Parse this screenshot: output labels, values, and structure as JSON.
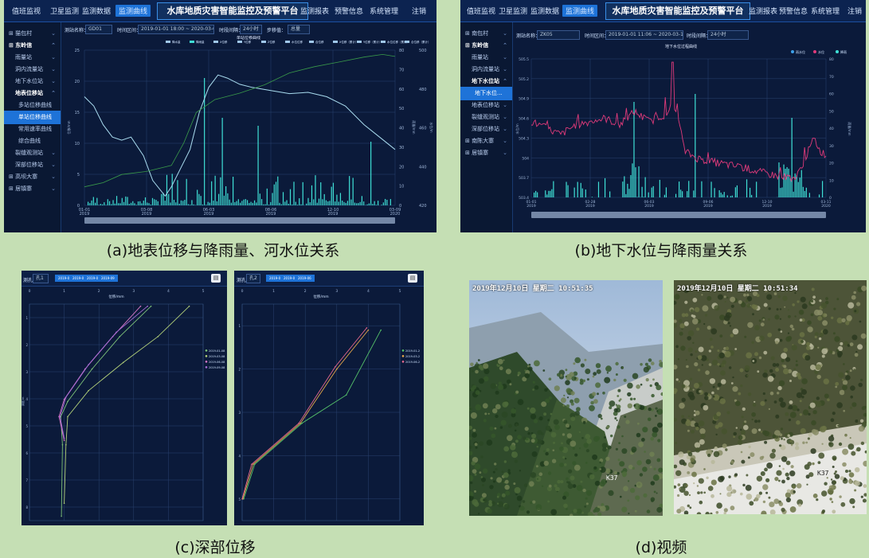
{
  "captions": {
    "a": "(a)地表位移与降雨量、河水位关系",
    "b": "(b)地下水位与降雨量关系",
    "c": "(c)深部位移",
    "d": "(d)视频"
  },
  "app": {
    "title": "水库地质灾害智能监控及预警平台",
    "nav_left": [
      "值班监视",
      "卫星监测",
      "监测数据",
      "监测曲线"
    ],
    "nav_right": [
      "监测报表",
      "预警信息",
      "系统管理"
    ],
    "logout": "注销"
  },
  "panel_a": {
    "sidebar": [
      {
        "label": "猫包村",
        "level": 0
      },
      {
        "label": "东岭信",
        "level": 0,
        "head": true
      },
      {
        "label": "雨量站",
        "level": 1
      },
      {
        "label": "洞内流量站",
        "level": 1
      },
      {
        "label": "地下水位站",
        "level": 1
      },
      {
        "label": "地表位移站",
        "level": 1,
        "head": true
      },
      {
        "label": "多站位移曲线",
        "level": 2
      },
      {
        "label": "单站位移曲线",
        "level": 2,
        "on": true
      },
      {
        "label": "常用速率曲线",
        "level": 2
      },
      {
        "label": "综合曲线",
        "level": 2
      },
      {
        "label": "裂缝观测站",
        "level": 1
      },
      {
        "label": "深部位移站",
        "level": 1
      },
      {
        "label": "高坝大寨",
        "level": 0
      },
      {
        "label": "居镇寨",
        "level": 0
      }
    ],
    "filters": {
      "station_label": "测站名称：",
      "station_value": "GD01",
      "time_label": "时间区间：",
      "time_value": "2019-01-01 18:00 ~ 2020-03-09 18:00",
      "step_label": "时段间隔：",
      "step_value": "24小时",
      "type_label": "步移值：",
      "type_value": "总量"
    },
    "chart_title": "单站位移曲线",
    "legend": [
      "降水量",
      "降雨量",
      "X位移",
      "Y位移",
      "Z位移",
      "水位位移",
      "合位移",
      "X位移（累计）",
      "Y位移（累计）",
      "水位位移（累计）",
      "合位移（累计）"
    ],
    "left_axis_ticks": [
      "0",
      "5",
      "10",
      "15",
      "20",
      "25"
    ],
    "right_axis1_ticks": [
      "0",
      "10",
      "20",
      "30",
      "40",
      "50",
      "60",
      "70",
      "80"
    ],
    "right_axis2_ticks": [
      "420",
      "440",
      "460",
      "480",
      "500"
    ],
    "x_ticks": [
      "01-01\n2019",
      "03-08\n2019",
      "06-03\n2019",
      "08-06\n2019",
      "12-10\n2019",
      "03-09\n2020"
    ],
    "left_axis_name": "位移/mm",
    "right_axis_name": "雨量/mm",
    "right_axis2_name": "水位/m"
  },
  "panel_b": {
    "sidebar": [
      {
        "label": "南包村",
        "level": 0
      },
      {
        "label": "东岭信",
        "level": 0,
        "head": true
      },
      {
        "label": "雨量站",
        "level": 1
      },
      {
        "label": "洞内流量站",
        "level": 1
      },
      {
        "label": "地下水位站",
        "level": 1,
        "head": true
      },
      {
        "label": "地下水位...",
        "level": 2,
        "on": true
      },
      {
        "label": "地表位移站",
        "level": 1
      },
      {
        "label": "裂缝观测站",
        "level": 1
      },
      {
        "label": "深部位移站",
        "level": 1
      },
      {
        "label": "南陈大寨",
        "level": 0
      },
      {
        "label": "居镇寨",
        "level": 0
      }
    ],
    "filters": {
      "station_label": "测站名称：",
      "station_value": "ZK05",
      "time_label": "时间区间：",
      "time_value": "2019-01-01 11:06 ~ 2020-03-11 11:06",
      "step_label": "时段间隔：",
      "step_value": "24小时"
    },
    "chart_title": "地下水位过程曲线",
    "legend": [
      "雨水位",
      "水位",
      "降雨"
    ],
    "left_axis_ticks": [
      "503.4",
      "503.7",
      "504",
      "504.3",
      "504.6",
      "504.9",
      "505.2",
      "505.5"
    ],
    "right_axis_ticks": [
      "0",
      "10",
      "20",
      "30",
      "40",
      "50",
      "60",
      "70",
      "80"
    ],
    "x_ticks": [
      "01-01\n2019",
      "02-28\n2019",
      "06-03\n2019",
      "09-06\n2019",
      "12-10\n2019",
      "03-11\n2020"
    ],
    "left_axis_name": "水位/m",
    "right_axis_name": "雨量/mm"
  },
  "panel_c": {
    "left": {
      "label": "测孔：",
      "select": "孔1",
      "tags": [
        "2019-01",
        "2019-03",
        "2019-06",
        "2019-09"
      ],
      "title": "位移/mm",
      "x_ticks": [
        "0",
        "1",
        "2",
        "3",
        "4",
        "5"
      ],
      "y_ticks": [
        "1",
        "2",
        "3",
        "4",
        "5",
        "6",
        "7",
        "8"
      ],
      "legend": [
        "2019-01-08",
        "2019-03-08",
        "2019-06-08",
        "2019-09-08"
      ],
      "y_name": "深度/m"
    },
    "right": {
      "label": "测孔：",
      "select": "孔2",
      "tags": [
        "2019-01",
        "2019-03",
        "2019-06"
      ],
      "title": "位移/mm",
      "x_ticks": [
        "0",
        "1",
        "2",
        "3",
        "4",
        "5"
      ],
      "y_ticks": [
        "1",
        "2",
        "3",
        "4",
        "5"
      ],
      "legend": [
        "2019-01-2",
        "2019-03-2",
        "2019-06-2"
      ]
    }
  },
  "panel_d": {
    "osd_left": "2019年12月10日 星期二 10:51:35",
    "osd_right": "2019年12月10日 星期二 10:51:34",
    "cam_left": "K37",
    "cam_right": "K37"
  },
  "colors": {
    "bg": "#0b1a3a",
    "accent": "#1e73d8",
    "rain": "#3fe0d6",
    "disp": "#a9dcef",
    "cum": "#3a9a4a",
    "gwl": "#e03a7a",
    "page_bg": "#c5dfb4"
  }
}
